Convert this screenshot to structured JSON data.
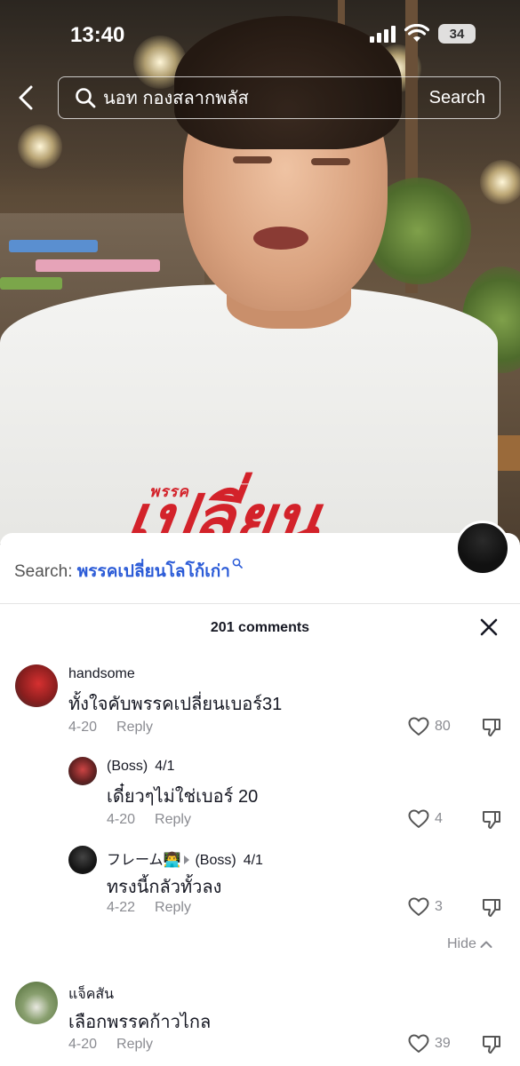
{
  "status_bar": {
    "time": "13:40",
    "battery": "34",
    "icons": [
      "signal-icon",
      "wifi-icon",
      "battery-icon"
    ]
  },
  "header": {
    "search_query": "นอท กองสลากพลัส",
    "search_button": "Search",
    "icons": [
      "back-icon",
      "search-icon"
    ]
  },
  "video": {
    "shirt_text_small": "พรรค",
    "shirt_text_big": "เปลี่ยน"
  },
  "sheet": {
    "search_label": "Search:",
    "search_keyword": "พรรคเปลี่ยนโลโก้เก่า",
    "comments_count": "201 comments",
    "hide_label": "Hide",
    "comments": [
      {
        "user": "handsome",
        "date": "",
        "text": "ทั้งใจคับพรรคเปลี่ยนเบอร์31",
        "time": "4-20",
        "reply_label": "Reply",
        "likes": "80"
      },
      {
        "user": "(Boss)",
        "date": "4/1",
        "text": "เดี๋ยวๆไม่ใช่เบอร์ 20",
        "time": "4-20",
        "reply_label": "Reply",
        "likes": "4"
      },
      {
        "user": "フレーム👨‍💻",
        "reply_to": "(Boss)",
        "date": "4/1",
        "text": "ทรงนี้กลัวทั้วลง",
        "time": "4-22",
        "reply_label": "Reply",
        "likes": "3"
      },
      {
        "user": "แจ็คสัน",
        "date": "",
        "text": "เลือกพรรคก้าวไกล",
        "time": "4-20",
        "reply_label": "Reply",
        "likes": "39"
      }
    ]
  },
  "colors": {
    "link_blue": "#2b5bd7",
    "shirt_red": "#d3222a",
    "meta_gray": "#8a8b91",
    "text_dark": "#161823"
  }
}
